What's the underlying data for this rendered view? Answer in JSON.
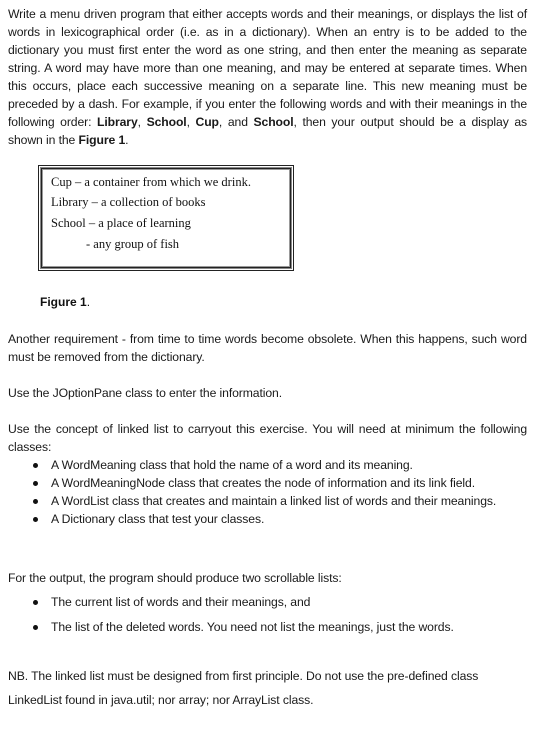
{
  "intro": {
    "text_before_words": "Write a menu driven program that either accepts words and their meanings, or displays the list of words in lexicographical order (i.e. as in a dictionary). When an entry is to be added to the dictionary you must first enter the word as one string, and then enter the meaning as separate string. A word may have more than one meaning, and may be entered at separate times. When this occurs, place each successive meaning on a separate line. This new meaning must be preceded by a dash. For example, if you enter the following words and with their meanings in the following order: ",
    "word1": "Library",
    "sep1": ", ",
    "word2": "School",
    "sep2": ", ",
    "word3": "Cup",
    "sep3": ", and ",
    "word4": "School",
    "text_after_words": ", then your output should be a display as shown in the ",
    "figure_ref": "Figure 1",
    "end": "."
  },
  "figure": {
    "lines": [
      "Cup – a container from which we drink.",
      "Library – a collection of books",
      "School – a place of learning",
      "- any group of fish"
    ],
    "caption": "Figure 1",
    "caption_end": "."
  },
  "paragraphs": {
    "obsolete": "Another requirement - from time to time words become obsolete. When this happens, such word must be removed from the dictionary.",
    "joptionpane": "Use the JOptionPane class to enter the information.",
    "linked_list": "Use the concept of linked list to carryout this exercise. You will need at minimum the following classes:"
  },
  "classes": [
    "A WordMeaning class that hold the name of a word and its meaning.",
    "A WordMeaningNode class that creates the node of information and its link field.",
    "A WordList class that creates and maintain a linked list of words and their meanings.",
    "A Dictionary class that test your classes."
  ],
  "output_section": {
    "intro": "For the output, the program should produce two scrollable lists:",
    "items": [
      "The current list of words and their meanings,  and",
      "The list of the deleted words. You need not list the meanings, just the words."
    ]
  },
  "nb": {
    "line1": "NB. The linked list must be designed from first principle. Do not use the pre-defined class",
    "line2": "LinkedList found in java.util; nor array; nor ArrayList class."
  }
}
